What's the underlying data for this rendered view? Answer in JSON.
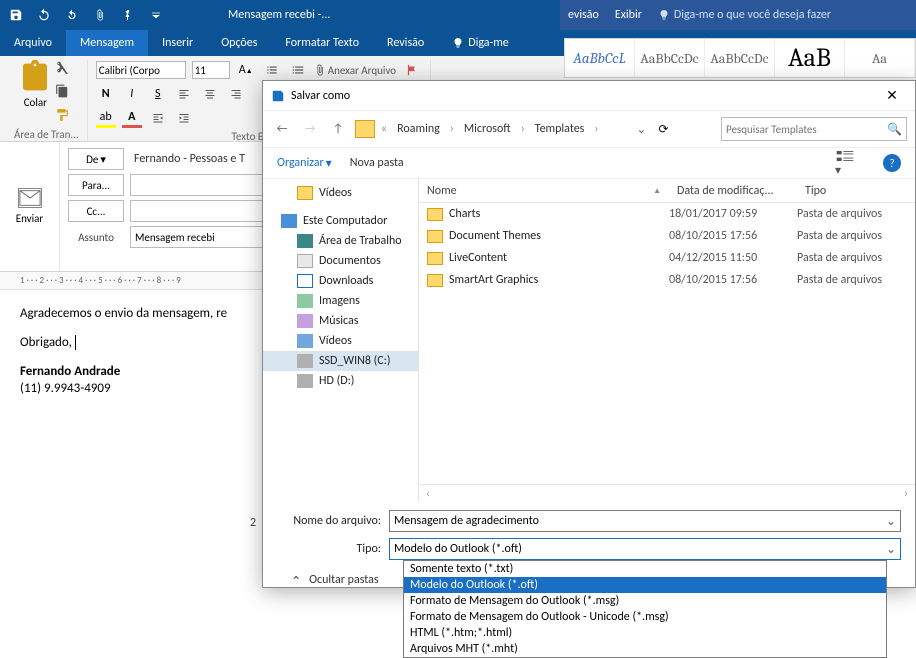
{
  "titlebar": {
    "title": "Mensagem recebi -..."
  },
  "bgapp": {
    "tabs": [
      "evisão",
      "Exibir"
    ],
    "tellme": "Diga-me o que você deseja fazer"
  },
  "tabs": {
    "file": "Arquivo",
    "message": "Mensagem",
    "insert": "Inserir",
    "options": "Opções",
    "format": "Formatar Texto",
    "review": "Revisão",
    "tellme": "Diga-me"
  },
  "ribbon": {
    "paste": "Colar",
    "clipboard_group": "Área de Tran...",
    "font_name": "Calibri (Corpo",
    "font_size": "11",
    "font_group": "Texto Básico",
    "attach": "Anexar Arquivo"
  },
  "styles": {
    "a": "AaBbCcL",
    "b": "AaBbCcDc",
    "c": "AaBbCcDc",
    "big": "AaB",
    "e": "Aa"
  },
  "compose": {
    "send": "Enviar",
    "from": "De",
    "to": "Para...",
    "cc": "Cc...",
    "subject_lbl": "Assunto",
    "subject_val": "Mensagem recebi",
    "from_display": "Fernando - Pessoas e T"
  },
  "ruler": "1 · · · 2 · · · 3 · · · 4 · · · 5 · · · 6 · · · 7 · · · 8 · · · 9",
  "body": {
    "p1": "Agradecemos o envio da mensagem, re",
    "p2": "Obrigado,",
    "sig_name": "Fernando Andrade",
    "sig_phone": "(11) 9.9943-4909"
  },
  "saveas": {
    "title": "Salvar como",
    "breadcrumb": [
      "Roaming",
      "Microsoft",
      "Templates"
    ],
    "search_placeholder": "Pesquisar Templates",
    "organize": "Organizar",
    "new_folder": "Nova pasta",
    "tree": {
      "videos_top": "Vídeos",
      "this_pc": "Este Computador",
      "desktop": "Área de Trabalho",
      "documents": "Documentos",
      "downloads": "Downloads",
      "images": "Imagens",
      "music": "Músicas",
      "videos": "Vídeos",
      "ssd": "SSD_WIN8 (C:)",
      "hd": "HD (D:)"
    },
    "cols": {
      "name": "Nome",
      "date": "Data de modificaç...",
      "type": "Tipo"
    },
    "rows": [
      {
        "name": "Charts",
        "date": "18/01/2017 09:59",
        "type": "Pasta de arquivos"
      },
      {
        "name": "Document Themes",
        "date": "08/10/2015 17:56",
        "type": "Pasta de arquivos"
      },
      {
        "name": "LiveContent",
        "date": "04/12/2015 11:50",
        "type": "Pasta de arquivos"
      },
      {
        "name": "SmartArt Graphics",
        "date": "08/10/2015 17:56",
        "type": "Pasta de arquivos"
      }
    ],
    "filename_lbl": "Nome do arquivo:",
    "filename_val": "Mensagem de agradecimento",
    "type_lbl": "Tipo:",
    "type_val": "Modelo do Outlook (*.oft)",
    "type_options": [
      "Somente texto (*.txt)",
      "Modelo do Outlook (*.oft)",
      "Formato de Mensagem do Outlook (*.msg)",
      "Formato de Mensagem do Outlook - Unicode (*.msg)",
      "HTML (*.htm;*.html)",
      "Arquivos MHT (*.mht)"
    ],
    "hide_folders": "Ocultar pastas"
  },
  "unsaved_time": "2"
}
